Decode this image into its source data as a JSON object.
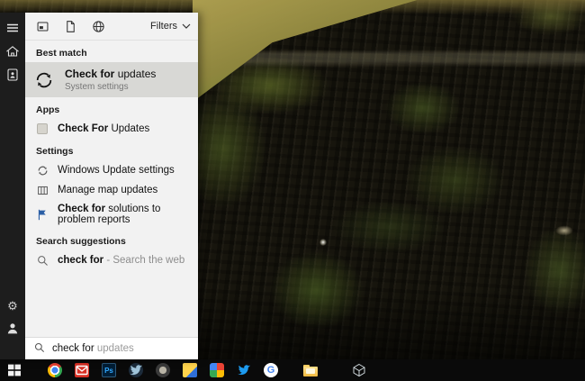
{
  "colors": {
    "panel_bg": "#f2f2f2",
    "rail_bg": "#1d1d1d",
    "highlight_row": "#d8d8d5",
    "taskbar_bg": "#0a0a0a",
    "flag_blue": "#2b5fa5"
  },
  "flyout": {
    "topbar": {
      "filters_label": "Filters"
    },
    "best_match": {
      "header": "Best match",
      "title_bold": "Check for",
      "title_rest": " updates",
      "subtitle": "System settings"
    },
    "apps": {
      "header": "Apps",
      "title_bold": "Check For",
      "title_rest": " Updates"
    },
    "settings": {
      "header": "Settings",
      "items": [
        {
          "label": "Windows Update settings"
        },
        {
          "label": "Manage map updates"
        },
        {
          "label_bold": "Check for",
          "label_rest": " solutions to problem reports"
        }
      ]
    },
    "suggestions": {
      "header": "Search suggestions",
      "query_bold": "check for",
      "query_rest": " - Search the web"
    },
    "searchbox": {
      "typed": "check for ",
      "suggestion": "updates"
    },
    "photoshop_label": "Ps",
    "google_label": "G"
  },
  "taskbar": {
    "icons": [
      "start",
      "chrome",
      "mail",
      "photoshop",
      "bird-app",
      "round-app",
      "docs-app",
      "photos-app",
      "twitter",
      "google",
      "file-explorer",
      "cube-app"
    ]
  }
}
